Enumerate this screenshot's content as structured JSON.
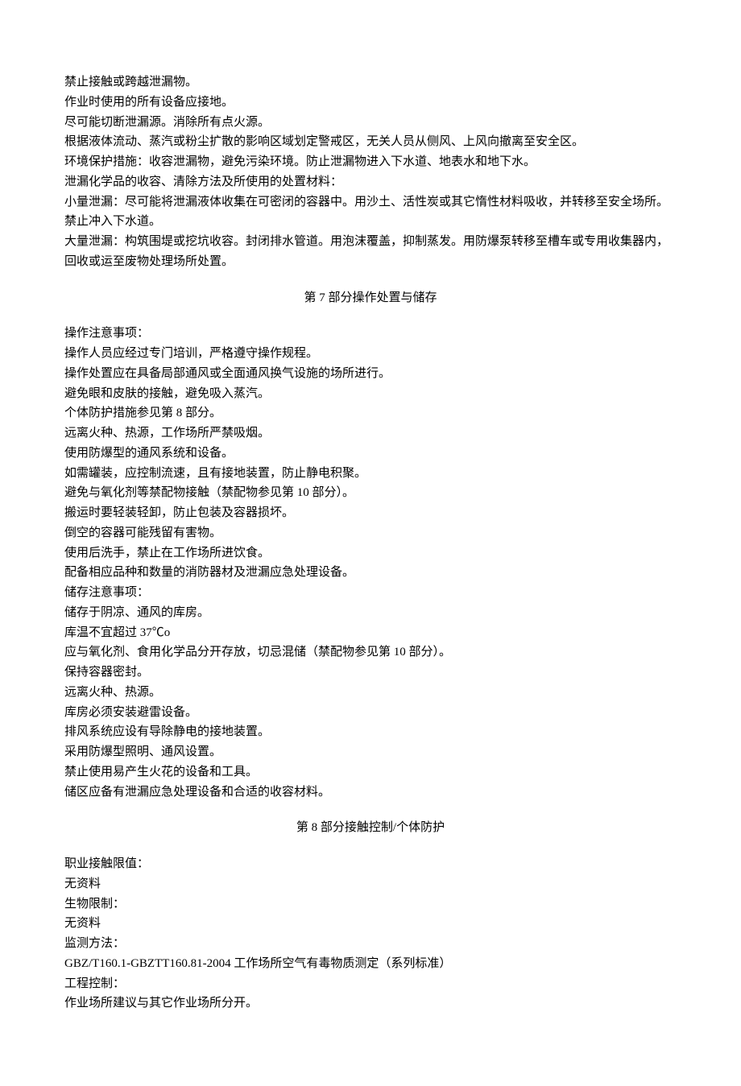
{
  "section6": {
    "lines": [
      "禁止接触或跨越泄漏物。",
      "作业时使用的所有设备应接地。",
      "尽可能切断泄漏源。消除所有点火源。",
      "根据液体流动、蒸汽或粉尘扩散的影响区域划定警戒区，无关人员从侧风、上风向撤离至安全区。",
      "环境保护措施：收容泄漏物，避免污染环境。防止泄漏物进入下水道、地表水和地下水。",
      "泄漏化学品的收容、清除方法及所使用的处置材料：",
      "小量泄漏：尽可能将泄漏液体收集在可密闭的容器中。用沙土、活性炭或其它惰性材料吸收，并转移至安全场所。禁止冲入下水道。",
      "大量泄漏：构筑围堤或挖坑收容。封闭排水管道。用泡沫覆盖，抑制蒸发。用防爆泵转移至槽车或专用收集器内，回收或运至废物处理场所处置。"
    ]
  },
  "section7": {
    "heading": "第 7 部分操作处置与储存",
    "lines": [
      "操作注意事项：",
      "操作人员应经过专门培训，严格遵守操作规程。",
      "操作处置应在具备局部通风或全面通风换气设施的场所进行。",
      "避免眼和皮肤的接触，避免吸入蒸汽。",
      "个体防护措施参见第 8 部分。",
      "远离火种、热源，工作场所严禁吸烟。",
      "使用防爆型的通风系统和设备。",
      "如需罐装，应控制流速，且有接地装置，防止静电积聚。",
      "避免与氧化剂等禁配物接触（禁配物参见第 10 部分）。",
      "搬运时要轻装轻卸，防止包装及容器损坏。",
      "倒空的容器可能残留有害物。",
      "使用后洗手，禁止在工作场所进饮食。",
      "配备相应品种和数量的消防器材及泄漏应急处理设备。",
      "储存注意事项：",
      "储存于阴凉、通风的库房。",
      "库温不宜超过 37℃o",
      "应与氧化剂、食用化学品分开存放，切忌混储（禁配物参见第 10 部分）。",
      "保持容器密封。",
      "远离火种、热源。",
      "库房必须安装避雷设备。",
      "排风系统应设有导除静电的接地装置。",
      "采用防爆型照明、通风设置。",
      "禁止使用易产生火花的设备和工具。",
      "储区应备有泄漏应急处理设备和合适的收容材料。"
    ]
  },
  "section8": {
    "heading": "第 8 部分接触控制/个体防护",
    "lines": [
      "职业接触限值：",
      "无资料",
      "生物限制：",
      "无资料",
      "监测方法：",
      "GBZ/T160.1-GBZTT160.81-2004 工作场所空气有毒物质测定（系列标准）",
      "工程控制：",
      "作业场所建议与其它作业场所分开。"
    ]
  }
}
